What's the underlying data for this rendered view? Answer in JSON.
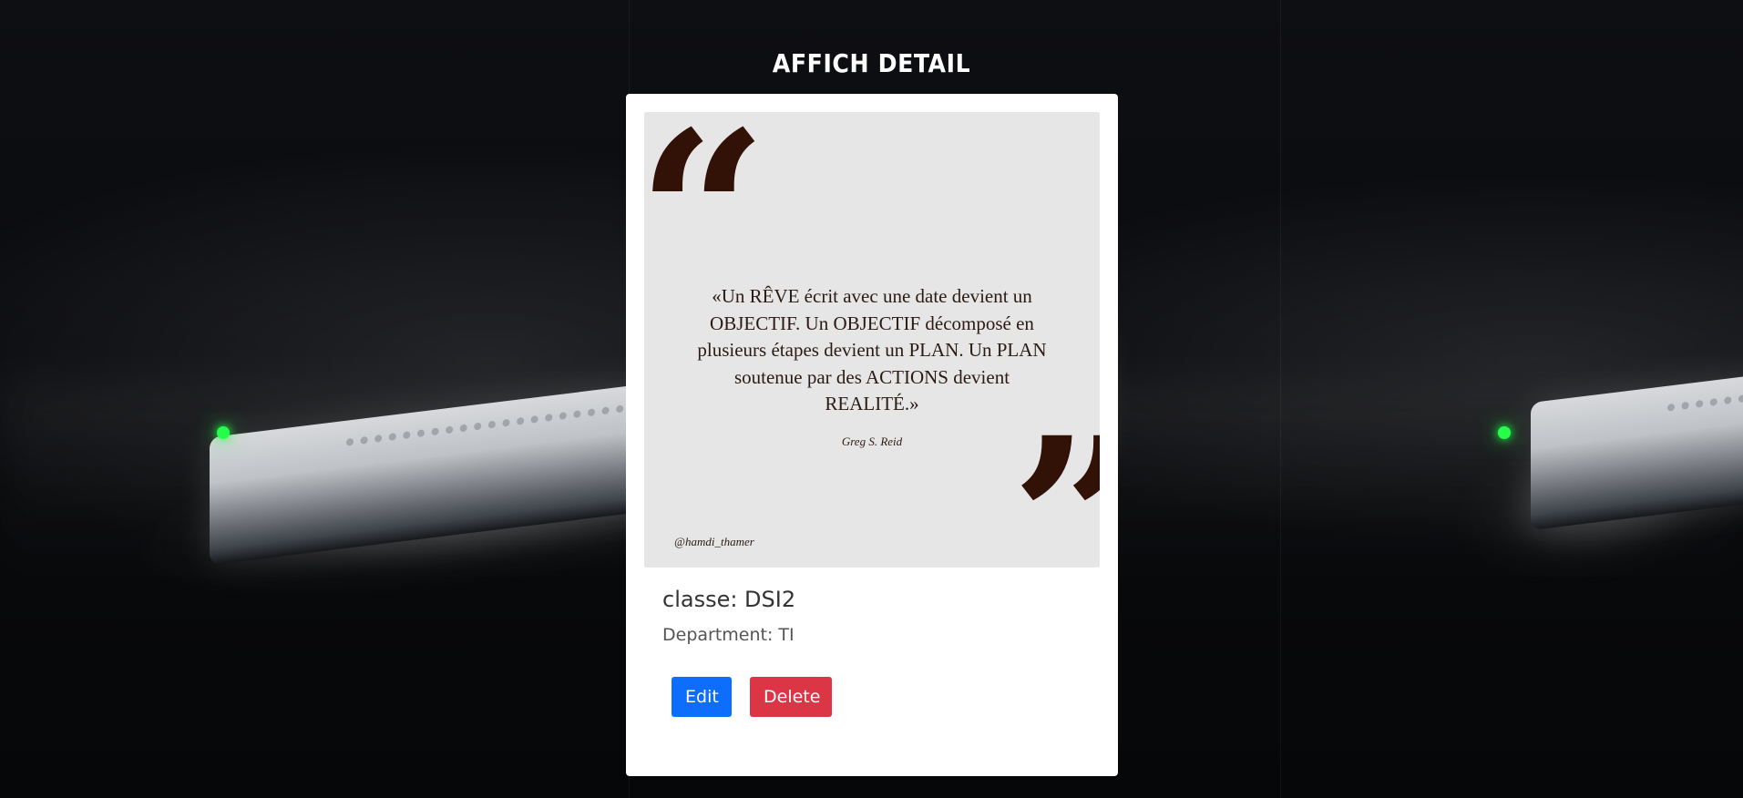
{
  "header": {
    "title": "AFFICH DETAIL"
  },
  "card": {
    "image": {
      "quote": "«Un RÊVE écrit avec une date devient un OBJECTIF. Un OBJECTIF décomposé en plusieurs étapes devient un PLAN. Un PLAN soutenue par des ACTIONS devient REALITÉ.»",
      "author": "Greg S. Reid",
      "handle": "@hamdi_thamer"
    },
    "classe": "classe: DSI2",
    "department": "Department: TI",
    "actions": {
      "edit_label": "Edit",
      "delete_label": "Delete"
    }
  },
  "colors": {
    "edit_button": "#0d6efd",
    "delete_button": "#dc3545"
  },
  "icons": {
    "open_quote": "“",
    "close_quote": "”"
  }
}
